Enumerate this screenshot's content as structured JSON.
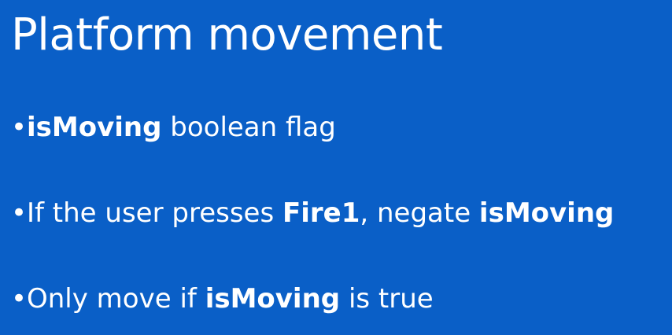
{
  "slide": {
    "title": "Platform movement",
    "bullets": [
      {
        "parts": [
          {
            "text": "isMoving",
            "bold": true
          },
          {
            "text": " boolean flag",
            "bold": false
          }
        ]
      },
      {
        "parts": [
          {
            "text": "If the user presses ",
            "bold": false
          },
          {
            "text": "Fire1",
            "bold": true
          },
          {
            "text": ", negate ",
            "bold": false
          },
          {
            "text": "isMoving",
            "bold": true
          }
        ]
      },
      {
        "parts": [
          {
            "text": "Only move if ",
            "bold": false
          },
          {
            "text": "isMoving",
            "bold": true
          },
          {
            "text": " is true",
            "bold": false
          }
        ]
      }
    ]
  }
}
